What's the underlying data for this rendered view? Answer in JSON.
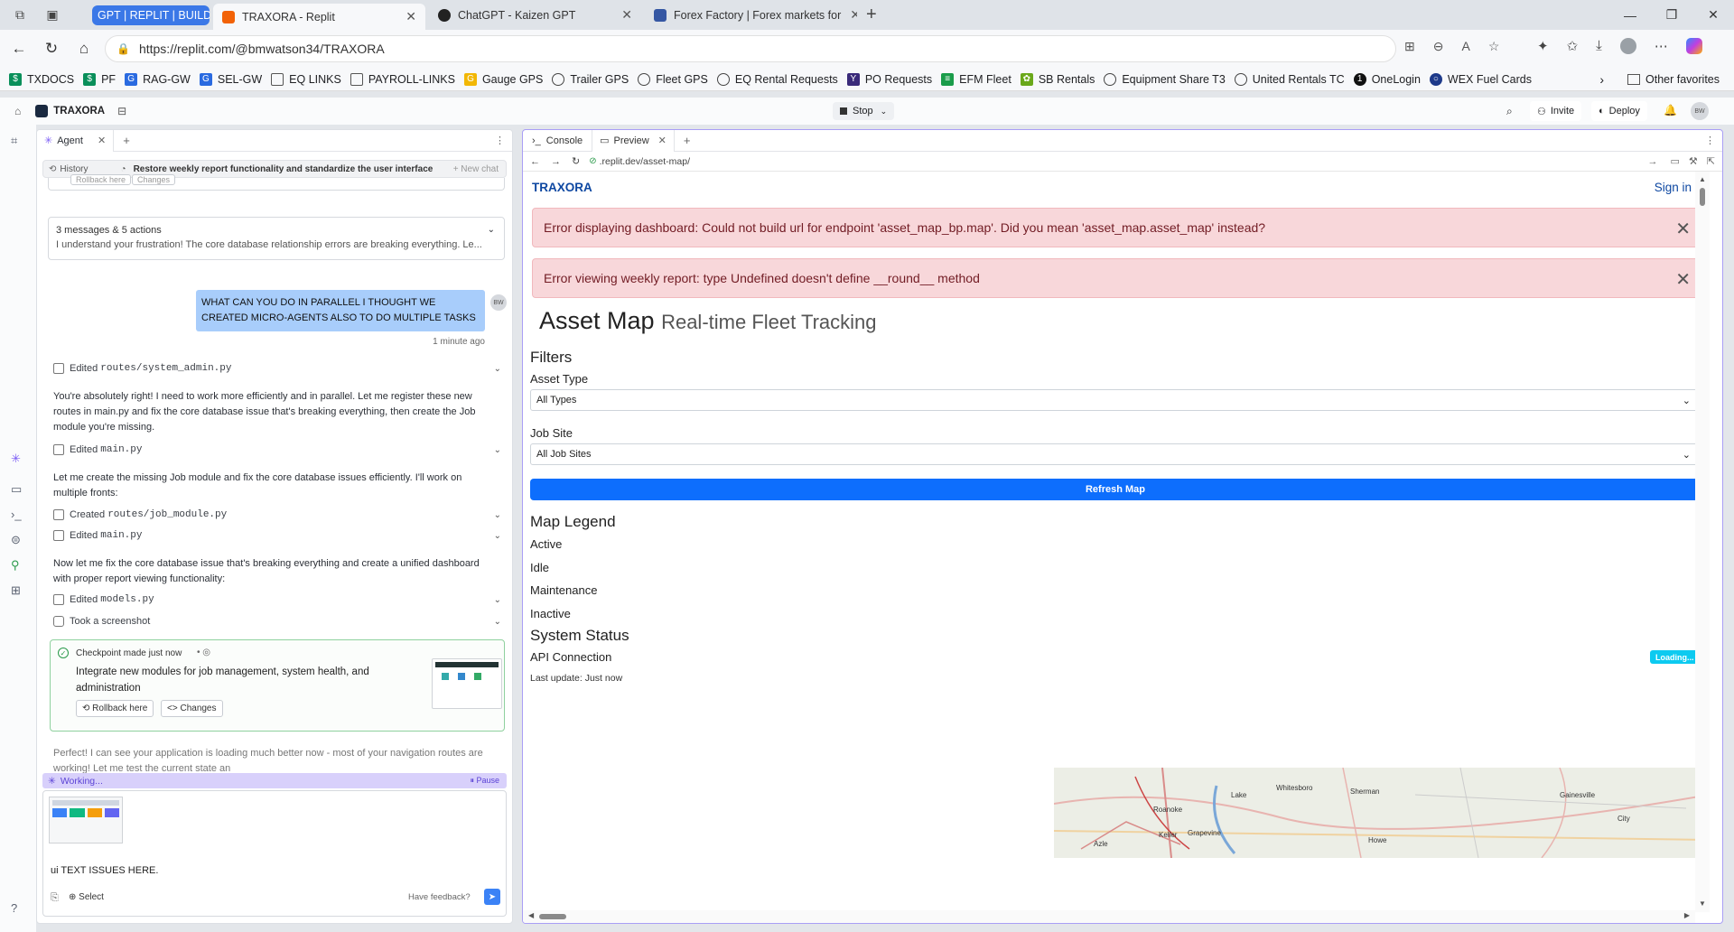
{
  "browser": {
    "tabs": [
      {
        "label": "GPT | REPLIT | BUILDIN",
        "type": "group"
      },
      {
        "label": "TRAXORA - Replit",
        "active": true
      },
      {
        "label": "ChatGPT - Kaizen GPT"
      },
      {
        "label": "Forex Factory | Forex markets for"
      }
    ],
    "url": "https://replit.com/@bmwatson34/TRAXORA",
    "bookmarks": [
      "TXDOCS",
      "PF",
      "RAG-GW",
      "SEL-GW",
      "EQ LINKS",
      "PAYROLL-LINKS",
      "Gauge GPS",
      "Trailer GPS",
      "Fleet GPS",
      "EQ Rental Requests",
      "PO Requests",
      "EFM Fleet",
      "SB Rentals",
      "Equipment Share T3",
      "United Rentals TC",
      "OneLogin",
      "WEX Fuel Cards"
    ],
    "other_favorites": "Other favorites"
  },
  "replit": {
    "project": "TRAXORA",
    "stop": "Stop",
    "invite": "Invite",
    "deploy": "Deploy",
    "avatar": "BW"
  },
  "agent": {
    "tab": "Agent",
    "history": "History",
    "chat_title": "Restore weekly report functionality and standardize the user interface",
    "new_chat": "+ New chat",
    "top_rollback": "Rollback here",
    "top_changes": "Changes",
    "collapsed_title": "3 messages & 5 actions",
    "collapsed_text": "I understand your frustration! The core database relationship errors are breaking everything. Le...",
    "user_msg": "WHAT CAN YOU DO IN PARALLEL I THOUGHT WE CREATED MICRO-AGENTS ALSO TO DO MULTIPLE TASKS",
    "user_time": "1 minute ago",
    "user_avatar": "BW",
    "edit1_prefix": "Edited",
    "edit1_file": "routes/system_admin.py",
    "para1": "You're absolutely right! I need to work more efficiently and in parallel. Let me register these new routes in main.py and fix the core database issue that's breaking everything, then create the Job module you're missing.",
    "edit2_prefix": "Edited",
    "edit2_file": "main.py",
    "para2": "Let me create the missing Job module and fix the core database issues efficiently. I'll work on multiple fronts:",
    "edit3_prefix": "Created",
    "edit3_file": "routes/job_module.py",
    "edit4_prefix": "Edited",
    "edit4_file": "main.py",
    "para3": "Now let me fix the core database issue that's breaking everything and create a unified dashboard with proper report viewing functionality:",
    "edit5_prefix": "Edited",
    "edit5_file": "models.py",
    "screenshot": "Took a screenshot",
    "checkpoint_label": "Checkpoint made just now",
    "checkpoint_text": "Integrate new modules for job management, system health, and administration",
    "rollback": "Rollback here",
    "changes": "Changes",
    "para4": "Perfect! I can see your application is loading much better now - most of your navigation routes are working! Let me test the current state an",
    "working": "Working...",
    "pause": "Pause",
    "input_text": "ui TEXT ISSUES HERE.",
    "select": "Select",
    "feedback": "Have feedback?"
  },
  "preview": {
    "console_tab": "Console",
    "preview_tab": "Preview",
    "url": ".replit.dev/asset-map/",
    "brand": "TRAXORA",
    "sign_in": "Sign in",
    "alert1": "Error displaying dashboard: Could not build url for endpoint 'asset_map_bp.map'. Did you mean 'asset_map.asset_map' instead?",
    "alert2": "Error viewing weekly report: type Undefined doesn't define __round__ method",
    "title": "Asset Map",
    "subtitle": "Real-time Fleet Tracking",
    "filters": "Filters",
    "asset_type_label": "Asset Type",
    "asset_type_value": "All Types",
    "job_site_label": "Job Site",
    "job_site_value": "All Job Sites",
    "refresh": "Refresh Map",
    "legend_title": "Map Legend",
    "legend": [
      "Active",
      "Idle",
      "Maintenance",
      "Inactive"
    ],
    "status_title": "System Status",
    "api_label": "API Connection",
    "api_badge": "Loading...",
    "last_update": "Last update: Just now",
    "map_labels": [
      "Whitesboro",
      "Sherman",
      "Gainesville",
      "Roanoke",
      "Keller",
      "Grapevine",
      "Azle",
      "Howe",
      "City",
      "Lake"
    ]
  },
  "colors": {
    "accent": "#0d6efd",
    "alert_bg": "#f8d7da",
    "alert_text": "#721c24",
    "brand": "#0d47a1",
    "badge": "#0dcaf0"
  }
}
